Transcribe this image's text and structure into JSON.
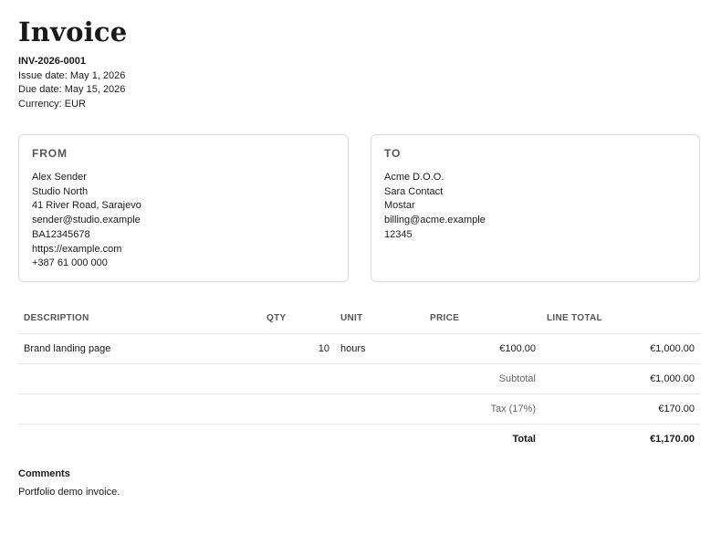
{
  "invoice": {
    "title": "Invoice",
    "number": "INV-2026-0001",
    "issue_date": "Issue date: May 1, 2026",
    "due_date": "Due date: May 15, 2026",
    "currency": "Currency: EUR"
  },
  "from": {
    "heading": "FROM",
    "lines": [
      "Alex Sender",
      "Studio North",
      "41 River Road, Sarajevo",
      "sender@studio.example",
      "BA12345678",
      "https://example.com",
      "+387 61 000 000"
    ]
  },
  "to": {
    "heading": "TO",
    "lines": [
      "Acme D.O.O.",
      "Sara Contact",
      "Mostar",
      "billing@acme.example",
      "12345"
    ]
  },
  "table": {
    "headers": {
      "description": "DESCRIPTION",
      "qty": "QTY",
      "unit": "UNIT",
      "price": "PRICE",
      "line_total": "LINE TOTAL"
    },
    "rows": [
      {
        "description": "Brand landing page",
        "qty": "10",
        "unit": "hours",
        "price": "€100.00",
        "line_total": "€1,000.00"
      }
    ],
    "subtotal_label": "Subtotal",
    "subtotal_value": "€1,000.00",
    "tax_label": "Tax (17%)",
    "tax_value": "€170.00",
    "total_label": "Total",
    "total_value": "€1,170.00"
  },
  "comments": {
    "heading": "Comments",
    "text": "Portfolio demo invoice."
  }
}
